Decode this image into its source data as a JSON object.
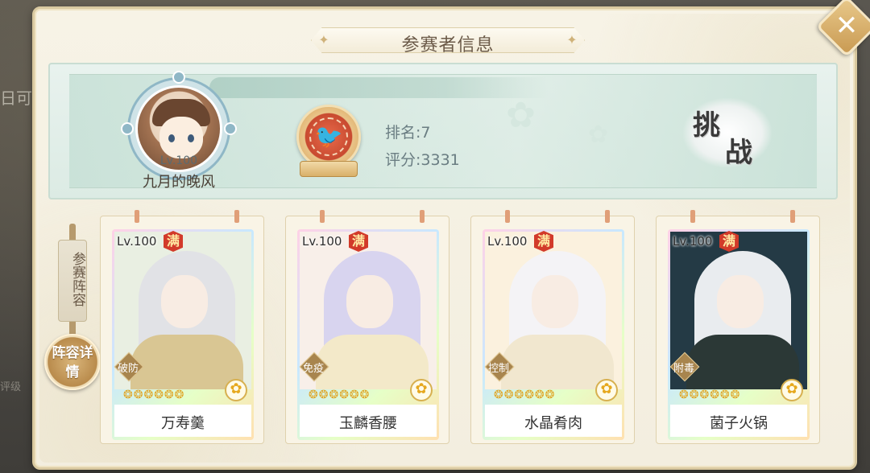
{
  "background": {
    "left_text": "日可",
    "left_text2": "评级"
  },
  "dialog": {
    "title": "参赛者信息",
    "close_icon": "close-icon"
  },
  "player": {
    "level": "Lv.100",
    "name": "九月的晚风",
    "rank": "排名:7",
    "score": "评分:3331"
  },
  "challenge": {
    "label_1": "挑",
    "label_2": "战"
  },
  "lineup": {
    "label": "参赛阵容",
    "detail_button": "阵容详情"
  },
  "cards": [
    {
      "level": "Lv.100",
      "badge": "满",
      "tag": "破防",
      "name": "万寿羹",
      "hair": "#e1e2e6",
      "body": "#d9c693",
      "bg": "#e9efe2"
    },
    {
      "level": "Lv.100",
      "badge": "满",
      "tag": "免疫",
      "name": "玉麟香腰",
      "hair": "#d8d4ef",
      "body": "#f3e9c9",
      "bg": "#f8efe9"
    },
    {
      "level": "Lv.100",
      "badge": "满",
      "tag": "控制",
      "name": "水晶肴肉",
      "hair": "#f4f3f6",
      "body": "#f1e7cf",
      "bg": "#fbf1de"
    },
    {
      "level": "Lv.100",
      "badge": "满",
      "tag": "附毒",
      "name": "菌子火锅",
      "hair": "#e9ecef",
      "body": "#2b3836",
      "bg": "#243a45"
    }
  ],
  "stars_text": "❂❂❂❂❂❂",
  "colors": {
    "accent_gold": "#cfb27a",
    "badge_red": "#d23a2a",
    "panel_bg": "#f7f3e6"
  }
}
